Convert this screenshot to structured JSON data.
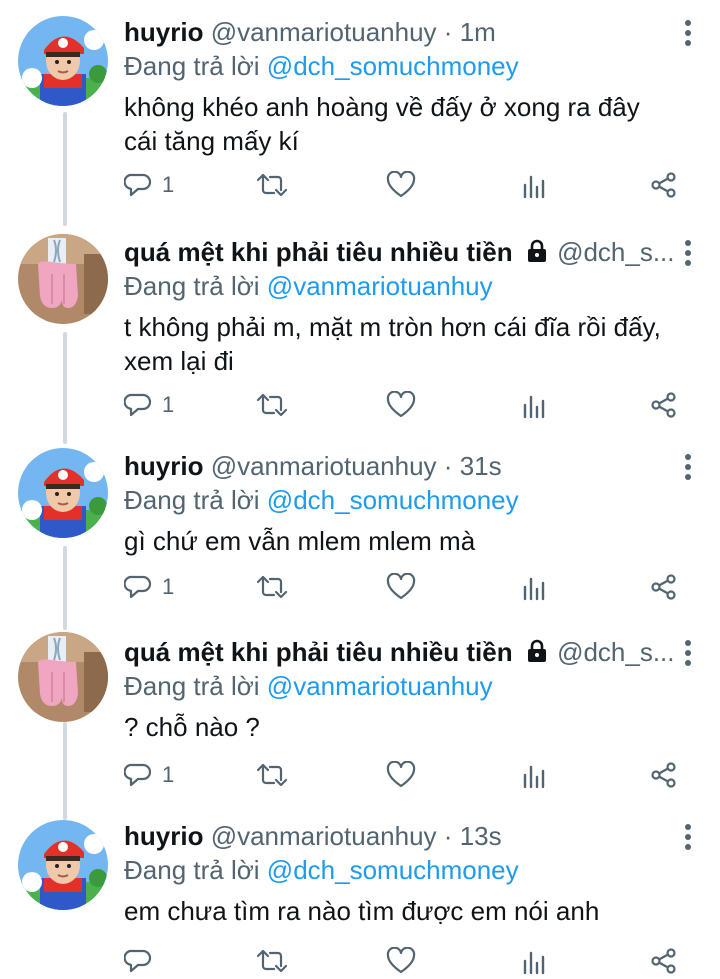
{
  "tweets": [
    {
      "name": "huyrio",
      "handle": "@vanmariotuanhuy",
      "dot": "·",
      "time": "1m",
      "locked": false,
      "reply_prefix": "Đang trả lời",
      "reply_to": "@dch_somuchmoney",
      "text": "không khéo anh hoàng về đấy ở xong ra đây cái tăng mấy kí",
      "reply_count": "1",
      "avatar": "mario-avatar"
    },
    {
      "name": "quá mệt khi phải tiêu nhiều tiền",
      "handle": "@dch_s...",
      "dot": "",
      "time": "",
      "locked": true,
      "reply_prefix": "Đang trả lời",
      "reply_to": "@vanmariotuanhuy",
      "text": "t không phải m, mặt m tròn hơn cái đĩa rồi đấy, xem lại đi",
      "reply_count": "1",
      "avatar": "pink-towel-avatar"
    },
    {
      "name": "huyrio",
      "handle": "@vanmariotuanhuy",
      "dot": "·",
      "time": "31s",
      "locked": false,
      "reply_prefix": "Đang trả lời",
      "reply_to": "@dch_somuchmoney",
      "text": "gì chứ em vẫn mlem mlem mà",
      "reply_count": "1",
      "avatar": "mario-avatar"
    },
    {
      "name": "quá mệt khi phải tiêu nhiều tiền",
      "handle": "@dch_s...",
      "dot": "",
      "time": "",
      "locked": true,
      "reply_prefix": "Đang trả lời",
      "reply_to": "@vanmariotuanhuy",
      "text": "? chỗ nào ?",
      "reply_count": "1",
      "avatar": "pink-towel-avatar"
    },
    {
      "name": "huyrio",
      "handle": "@vanmariotuanhuy",
      "dot": "·",
      "time": "13s",
      "locked": false,
      "reply_prefix": "Đang trả lời",
      "reply_to": "@dch_somuchmoney",
      "text": "em chưa tìm ra nào tìm được em nói anh",
      "reply_count": "",
      "avatar": "mario-avatar"
    }
  ],
  "icons": {
    "reply": "reply-icon",
    "retweet": "retweet-icon",
    "like": "like-icon",
    "analytics": "analytics-icon",
    "share": "share-icon",
    "more": "more-icon",
    "lock": "lock-icon"
  },
  "colors": {
    "text": "#0f1419",
    "secondary": "#536471",
    "link": "#1d9bf0",
    "thread_line": "#cfd9de"
  }
}
